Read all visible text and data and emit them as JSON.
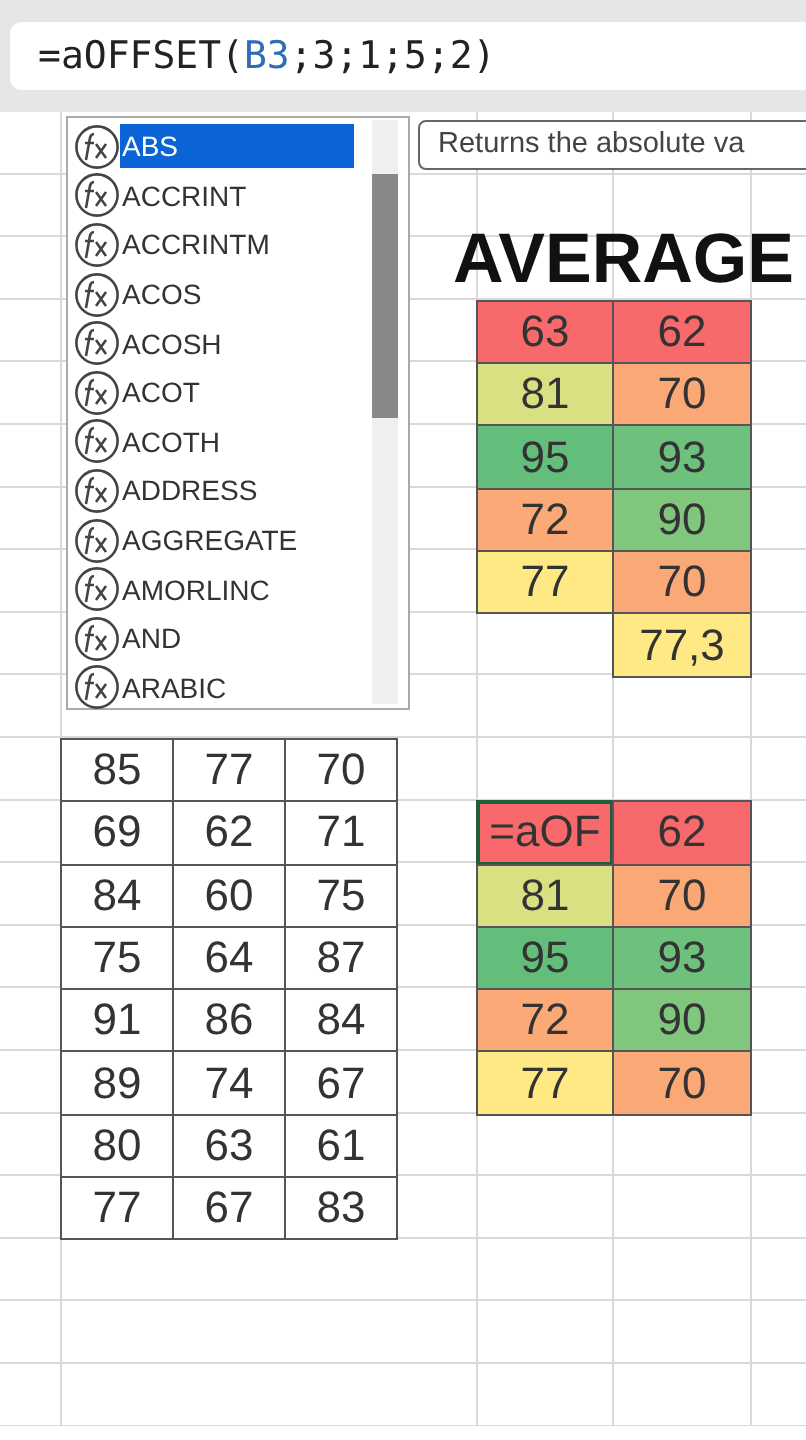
{
  "formula_bar": {
    "segments": [
      {
        "kind": "plain",
        "text": "=aOFFSET("
      },
      {
        "kind": "ref",
        "text": "B3"
      },
      {
        "kind": "plain",
        "text": ";3;1;5;2)"
      }
    ]
  },
  "autocomplete": {
    "items": [
      {
        "label": "ABS",
        "selected": true
      },
      {
        "label": "ACCRINT",
        "selected": false
      },
      {
        "label": "ACCRINTM",
        "selected": false
      },
      {
        "label": "ACOS",
        "selected": false
      },
      {
        "label": "ACOSH",
        "selected": false
      },
      {
        "label": "ACOT",
        "selected": false
      },
      {
        "label": "ACOTH",
        "selected": false
      },
      {
        "label": "ADDRESS",
        "selected": false
      },
      {
        "label": "AGGREGATE",
        "selected": false
      },
      {
        "label": "AMORLINC",
        "selected": false
      },
      {
        "label": "AND",
        "selected": false
      },
      {
        "label": "ARABIC",
        "selected": false
      }
    ],
    "tooltip": "Returns the absolute va"
  },
  "heading": "AVERAGE",
  "left_table": {
    "rows": [
      [
        "85",
        "77",
        "70"
      ],
      [
        "69",
        "62",
        "71"
      ],
      [
        "84",
        "60",
        "75"
      ],
      [
        "75",
        "64",
        "87"
      ],
      [
        "91",
        "86",
        "84"
      ],
      [
        "89",
        "74",
        "67"
      ],
      [
        "80",
        "63",
        "61"
      ],
      [
        "77",
        "67",
        "83"
      ]
    ]
  },
  "top_table": {
    "rows": [
      [
        {
          "value": "63",
          "color": "#f8696b"
        },
        {
          "value": "62",
          "color": "#f8696b"
        }
      ],
      [
        {
          "value": "81",
          "color": "#d9e082"
        },
        {
          "value": "70",
          "color": "#fba877"
        }
      ],
      [
        {
          "value": "95",
          "color": "#63be7b"
        },
        {
          "value": "93",
          "color": "#6ec17c"
        }
      ],
      [
        {
          "value": "72",
          "color": "#fbaa77"
        },
        {
          "value": "90",
          "color": "#80c77d"
        }
      ],
      [
        {
          "value": "77",
          "color": "#ffe984"
        },
        {
          "value": "70",
          "color": "#fba877"
        }
      ]
    ],
    "average": {
      "value": "77,3",
      "color": "#ffe984"
    }
  },
  "bottom_table": {
    "rows": [
      [
        {
          "value": "=aOF",
          "color": "#f8696b",
          "active": true
        },
        {
          "value": "62",
          "color": "#f8696b",
          "active": false
        }
      ],
      [
        {
          "value": "81",
          "color": "#d9e082",
          "active": false
        },
        {
          "value": "70",
          "color": "#fba877",
          "active": false
        }
      ],
      [
        {
          "value": "95",
          "color": "#63be7b",
          "active": false
        },
        {
          "value": "93",
          "color": "#6ec17c",
          "active": false
        }
      ],
      [
        {
          "value": "72",
          "color": "#fbaa77",
          "active": false
        },
        {
          "value": "90",
          "color": "#80c77d",
          "active": false
        }
      ],
      [
        {
          "value": "77",
          "color": "#ffe984",
          "active": false
        },
        {
          "value": "70",
          "color": "#fba877",
          "active": false
        }
      ]
    ]
  }
}
